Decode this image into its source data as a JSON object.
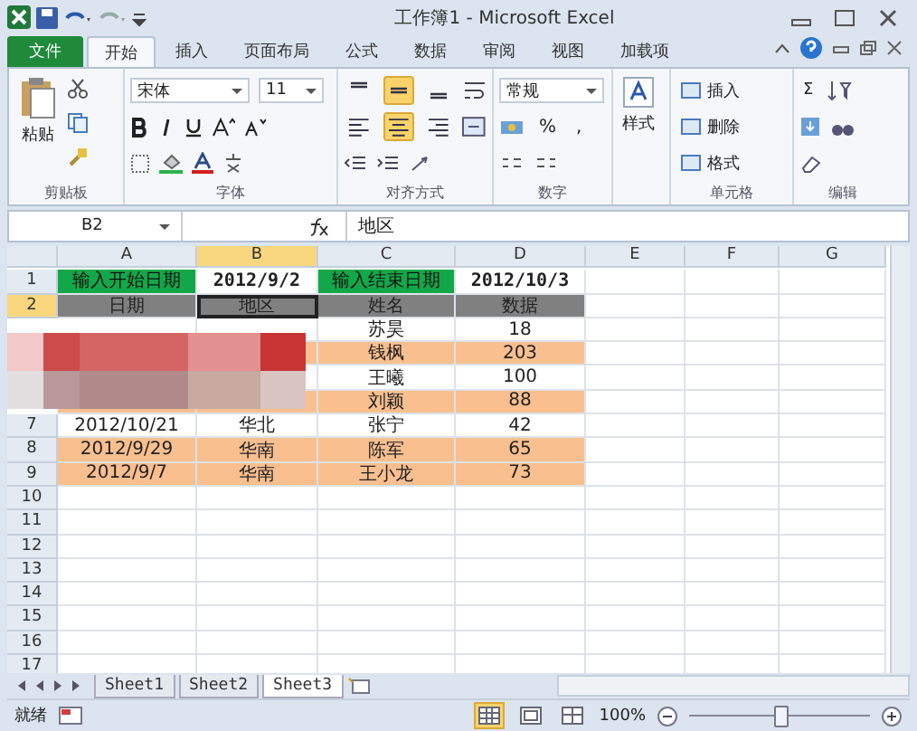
{
  "window": {
    "title": "工作簿1 - Microsoft Excel"
  },
  "ribbon_tabs": [
    {
      "label": "文件",
      "kind": "file",
      "selected": false
    },
    {
      "label": "开始",
      "kind": "tab",
      "selected": true
    },
    {
      "label": "插入",
      "kind": "tab",
      "selected": false
    },
    {
      "label": "页面布局",
      "kind": "tab",
      "selected": false
    },
    {
      "label": "公式",
      "kind": "tab",
      "selected": false
    },
    {
      "label": "数据",
      "kind": "tab",
      "selected": false
    },
    {
      "label": "审阅",
      "kind": "tab",
      "selected": false
    },
    {
      "label": "视图",
      "kind": "tab",
      "selected": false
    },
    {
      "label": "加载项",
      "kind": "tab",
      "selected": false
    }
  ],
  "ribbon": {
    "clipboard": {
      "paste": "粘贴",
      "label": "剪贴板"
    },
    "font": {
      "name": "宋体",
      "size": "11",
      "label": "字体"
    },
    "alignment": {
      "vertical": [
        {
          "selected": false
        },
        {
          "selected": true
        },
        {
          "selected": false
        }
      ],
      "horizontal": [
        {
          "selected": false
        },
        {
          "selected": true
        },
        {
          "selected": false
        }
      ],
      "label": "对齐方式"
    },
    "number": {
      "format": "常规",
      "percent": "%",
      "comma": ",",
      "label": "数字"
    },
    "styles": {
      "label": "样式"
    },
    "cells": {
      "items": [
        "插入",
        "删除",
        "格式"
      ],
      "label": "单元格"
    },
    "editing": {
      "sum": "Σ",
      "label": "编辑"
    }
  },
  "formula_bar": {
    "name_box": "B2",
    "content": "地区"
  },
  "columns": [
    {
      "label": "A",
      "selected": false
    },
    {
      "label": "B",
      "selected": true
    },
    {
      "label": "C",
      "selected": false
    },
    {
      "label": "D",
      "selected": false
    },
    {
      "label": "E",
      "selected": false
    },
    {
      "label": "F",
      "selected": false
    },
    {
      "label": "G",
      "selected": false
    }
  ],
  "rows": [
    {
      "number": "1",
      "selected": false,
      "cells": [
        {
          "text": "输入开始日期",
          "kind": "green"
        },
        {
          "text": "2012/9/2",
          "kind": "input"
        },
        {
          "text": "输入结束日期",
          "kind": "green"
        },
        {
          "text": "2012/10/3",
          "kind": "input"
        }
      ]
    },
    {
      "number": "2",
      "selected": true,
      "kind": "header",
      "cells": [
        {
          "text": "日期"
        },
        {
          "text": "地区"
        },
        {
          "text": "姓名"
        },
        {
          "text": "数据"
        }
      ]
    },
    {
      "kind": "plain",
      "cells": [
        {},
        {},
        {
          "text": "苏昊"
        },
        {
          "text": "18"
        }
      ]
    },
    {
      "kind": "band",
      "cells": [
        null,
        {},
        {
          "text": "钱枫"
        },
        {
          "text": "203"
        }
      ]
    },
    {
      "kind": "plain",
      "cells": [
        null,
        {},
        {
          "text": "王曦"
        },
        {
          "text": "100"
        }
      ]
    },
    {
      "kind": "band",
      "cells": [
        {},
        {},
        {
          "text": "刘颖"
        },
        {
          "text": "88"
        }
      ]
    },
    {
      "number": "7",
      "selected": false,
      "kind": "plain",
      "cells": [
        {
          "text": "2012/10/21"
        },
        {
          "text": "华北"
        },
        {
          "text": "张宁"
        },
        {
          "text": "42"
        }
      ]
    },
    {
      "number": "8",
      "selected": false,
      "kind": "band",
      "cells": [
        {
          "text": "2012/9/29"
        },
        {
          "text": "华南"
        },
        {
          "text": "陈军"
        },
        {
          "text": "65"
        }
      ]
    },
    {
      "number": "9",
      "selected": false,
      "kind": "band",
      "cells": [
        {
          "text": "2012/9/7"
        },
        {
          "text": "华南"
        },
        {
          "text": "王小龙"
        },
        {
          "text": "73"
        }
      ]
    },
    {
      "number": "10",
      "selected": false,
      "cells": []
    },
    {
      "number": "11",
      "selected": false,
      "cells": []
    },
    {
      "number": "12",
      "selected": false,
      "cells": []
    },
    {
      "number": "13",
      "selected": false,
      "cells": []
    },
    {
      "number": "14",
      "selected": false,
      "cells": []
    },
    {
      "number": "15",
      "selected": false,
      "cells": []
    },
    {
      "number": "16",
      "selected": false,
      "cells": []
    },
    {
      "number": "17",
      "selected": false,
      "cells": []
    }
  ],
  "sheets": [
    {
      "label": "Sheet1",
      "selected": false
    },
    {
      "label": "Sheet2",
      "selected": false
    },
    {
      "label": "Sheet3",
      "selected": true
    }
  ],
  "status_bar": {
    "status": "就绪",
    "views": [
      {
        "selected": true
      },
      {
        "selected": false
      },
      {
        "selected": false
      }
    ],
    "zoom": "100%",
    "zoom_slider": {
      "level": 0.5
    }
  }
}
